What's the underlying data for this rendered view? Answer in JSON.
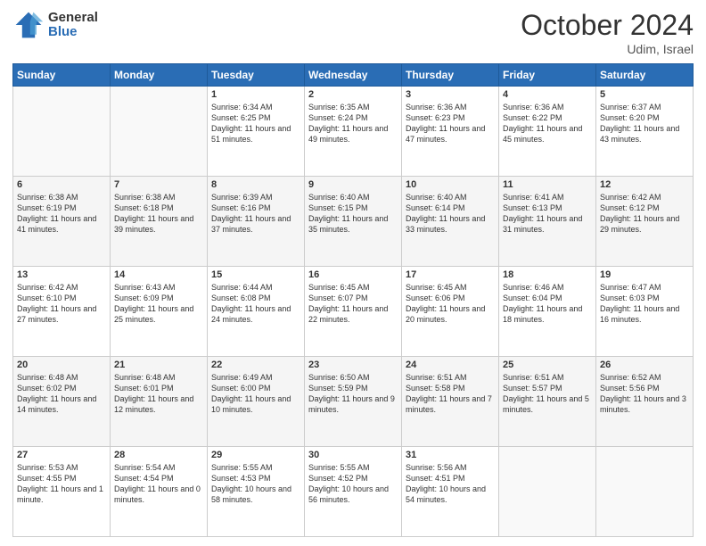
{
  "logo": {
    "general": "General",
    "blue": "Blue"
  },
  "header": {
    "month": "October 2024",
    "location": "Udim, Israel"
  },
  "days_of_week": [
    "Sunday",
    "Monday",
    "Tuesday",
    "Wednesday",
    "Thursday",
    "Friday",
    "Saturday"
  ],
  "weeks": [
    [
      {
        "day": "",
        "info": ""
      },
      {
        "day": "",
        "info": ""
      },
      {
        "day": "1",
        "info": "Sunrise: 6:34 AM\nSunset: 6:25 PM\nDaylight: 11 hours and 51 minutes."
      },
      {
        "day": "2",
        "info": "Sunrise: 6:35 AM\nSunset: 6:24 PM\nDaylight: 11 hours and 49 minutes."
      },
      {
        "day": "3",
        "info": "Sunrise: 6:36 AM\nSunset: 6:23 PM\nDaylight: 11 hours and 47 minutes."
      },
      {
        "day": "4",
        "info": "Sunrise: 6:36 AM\nSunset: 6:22 PM\nDaylight: 11 hours and 45 minutes."
      },
      {
        "day": "5",
        "info": "Sunrise: 6:37 AM\nSunset: 6:20 PM\nDaylight: 11 hours and 43 minutes."
      }
    ],
    [
      {
        "day": "6",
        "info": "Sunrise: 6:38 AM\nSunset: 6:19 PM\nDaylight: 11 hours and 41 minutes."
      },
      {
        "day": "7",
        "info": "Sunrise: 6:38 AM\nSunset: 6:18 PM\nDaylight: 11 hours and 39 minutes."
      },
      {
        "day": "8",
        "info": "Sunrise: 6:39 AM\nSunset: 6:16 PM\nDaylight: 11 hours and 37 minutes."
      },
      {
        "day": "9",
        "info": "Sunrise: 6:40 AM\nSunset: 6:15 PM\nDaylight: 11 hours and 35 minutes."
      },
      {
        "day": "10",
        "info": "Sunrise: 6:40 AM\nSunset: 6:14 PM\nDaylight: 11 hours and 33 minutes."
      },
      {
        "day": "11",
        "info": "Sunrise: 6:41 AM\nSunset: 6:13 PM\nDaylight: 11 hours and 31 minutes."
      },
      {
        "day": "12",
        "info": "Sunrise: 6:42 AM\nSunset: 6:12 PM\nDaylight: 11 hours and 29 minutes."
      }
    ],
    [
      {
        "day": "13",
        "info": "Sunrise: 6:42 AM\nSunset: 6:10 PM\nDaylight: 11 hours and 27 minutes."
      },
      {
        "day": "14",
        "info": "Sunrise: 6:43 AM\nSunset: 6:09 PM\nDaylight: 11 hours and 25 minutes."
      },
      {
        "day": "15",
        "info": "Sunrise: 6:44 AM\nSunset: 6:08 PM\nDaylight: 11 hours and 24 minutes."
      },
      {
        "day": "16",
        "info": "Sunrise: 6:45 AM\nSunset: 6:07 PM\nDaylight: 11 hours and 22 minutes."
      },
      {
        "day": "17",
        "info": "Sunrise: 6:45 AM\nSunset: 6:06 PM\nDaylight: 11 hours and 20 minutes."
      },
      {
        "day": "18",
        "info": "Sunrise: 6:46 AM\nSunset: 6:04 PM\nDaylight: 11 hours and 18 minutes."
      },
      {
        "day": "19",
        "info": "Sunrise: 6:47 AM\nSunset: 6:03 PM\nDaylight: 11 hours and 16 minutes."
      }
    ],
    [
      {
        "day": "20",
        "info": "Sunrise: 6:48 AM\nSunset: 6:02 PM\nDaylight: 11 hours and 14 minutes."
      },
      {
        "day": "21",
        "info": "Sunrise: 6:48 AM\nSunset: 6:01 PM\nDaylight: 11 hours and 12 minutes."
      },
      {
        "day": "22",
        "info": "Sunrise: 6:49 AM\nSunset: 6:00 PM\nDaylight: 11 hours and 10 minutes."
      },
      {
        "day": "23",
        "info": "Sunrise: 6:50 AM\nSunset: 5:59 PM\nDaylight: 11 hours and 9 minutes."
      },
      {
        "day": "24",
        "info": "Sunrise: 6:51 AM\nSunset: 5:58 PM\nDaylight: 11 hours and 7 minutes."
      },
      {
        "day": "25",
        "info": "Sunrise: 6:51 AM\nSunset: 5:57 PM\nDaylight: 11 hours and 5 minutes."
      },
      {
        "day": "26",
        "info": "Sunrise: 6:52 AM\nSunset: 5:56 PM\nDaylight: 11 hours and 3 minutes."
      }
    ],
    [
      {
        "day": "27",
        "info": "Sunrise: 5:53 AM\nSunset: 4:55 PM\nDaylight: 11 hours and 1 minute."
      },
      {
        "day": "28",
        "info": "Sunrise: 5:54 AM\nSunset: 4:54 PM\nDaylight: 11 hours and 0 minutes."
      },
      {
        "day": "29",
        "info": "Sunrise: 5:55 AM\nSunset: 4:53 PM\nDaylight: 10 hours and 58 minutes."
      },
      {
        "day": "30",
        "info": "Sunrise: 5:55 AM\nSunset: 4:52 PM\nDaylight: 10 hours and 56 minutes."
      },
      {
        "day": "31",
        "info": "Sunrise: 5:56 AM\nSunset: 4:51 PM\nDaylight: 10 hours and 54 minutes."
      },
      {
        "day": "",
        "info": ""
      },
      {
        "day": "",
        "info": ""
      }
    ]
  ]
}
